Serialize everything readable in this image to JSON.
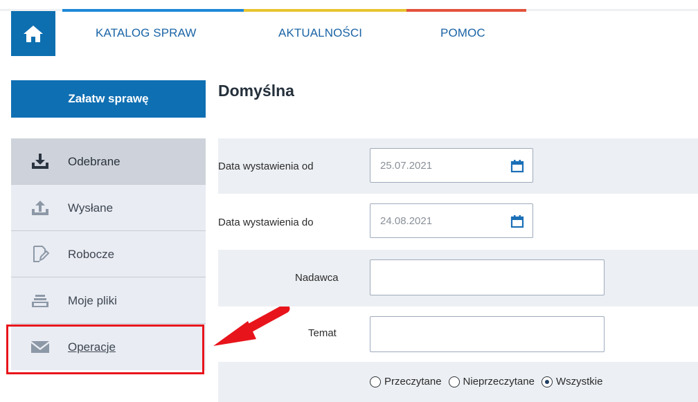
{
  "header": {
    "nav": [
      "KATALOG SPRAW",
      "AKTUALNOŚCI",
      "POMOC"
    ],
    "accent_colors": [
      "#1e88d8",
      "#e8c330",
      "#e3523b"
    ],
    "home_icon": "home-icon"
  },
  "sidebar": {
    "primary_button": "Załatw sprawę",
    "items": [
      {
        "label": "Odebrane",
        "icon": "inbox-download-icon",
        "active": true
      },
      {
        "label": "Wysłane",
        "icon": "upload-icon"
      },
      {
        "label": "Robocze",
        "icon": "draft-edit-icon"
      },
      {
        "label": "Moje pliki",
        "icon": "file-tray-icon"
      },
      {
        "label": "Operacje",
        "icon": "envelope-icon",
        "highlighted": true
      }
    ]
  },
  "main": {
    "title": "Domyślna",
    "filters": {
      "date_from_label": "Data wystawienia od",
      "date_from_value": "25.07.2021",
      "date_to_label": "Data wystawienia do",
      "date_to_value": "24.08.2021",
      "sender_label": "Nadawca",
      "sender_value": "",
      "subject_label": "Temat",
      "subject_value": "",
      "read_options": [
        "Przeczytane",
        "Nieprzeczytane",
        "Wszystkie"
      ],
      "read_selected": "Wszystkie"
    }
  },
  "annotation": {
    "color": "#e8141b"
  }
}
